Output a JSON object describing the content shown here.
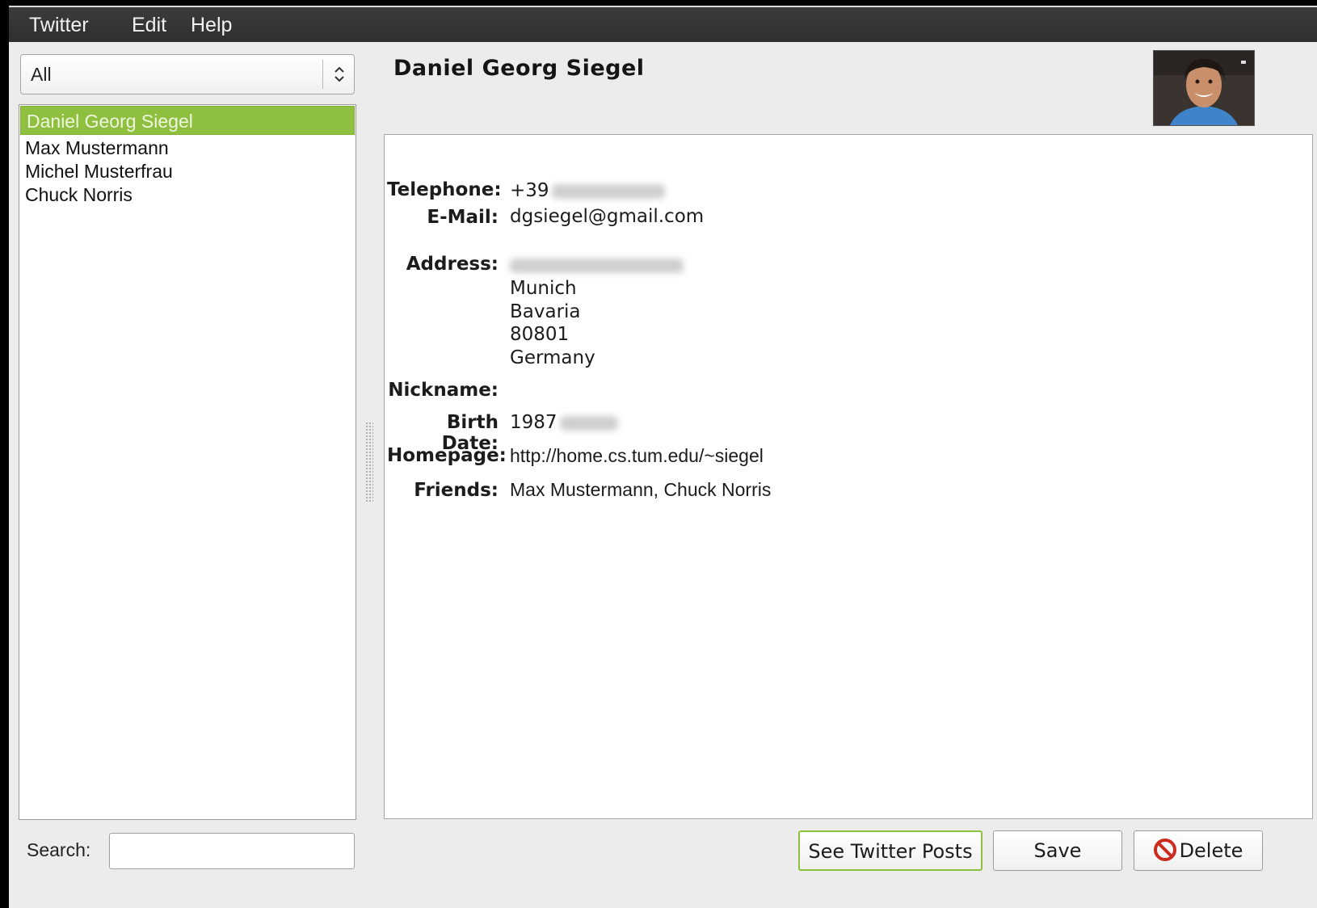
{
  "menu": {
    "items": [
      "Twitter",
      "Edit",
      "Help"
    ]
  },
  "sidebar": {
    "filter_value": "All",
    "contacts": [
      "Daniel Georg Siegel",
      "Max Mustermann",
      "Michel Musterfrau",
      "Chuck Norris"
    ],
    "selected_index": 0,
    "search_label": "Search:",
    "search_value": ""
  },
  "contact": {
    "name": "Daniel Georg Siegel",
    "fields": {
      "telephone_label": "Telephone:",
      "telephone_value": "+39",
      "email_label": "E-Mail:",
      "email_value": "dgsiegel@gmail.com",
      "address_label": "Address:",
      "address_lines": [
        "Munich",
        "Bavaria",
        "80801",
        "Germany"
      ],
      "nickname_label": "Nickname:",
      "nickname_value": "",
      "birthdate_label": "Birth Date:",
      "birthdate_value": "1987",
      "homepage_label": "Homepage:",
      "homepage_value": "http://home.cs.tum.edu/~siegel",
      "friends_label": "Friends:",
      "friends_value": "Max Mustermann, Chuck Norris"
    }
  },
  "buttons": {
    "twitter_posts": "See Twitter Posts",
    "save": "Save",
    "delete": "Delete"
  },
  "colors": {
    "selection": "#8fbf3f",
    "menubar": "#333333",
    "window_bg": "#ececec",
    "delete_icon": "#cc2a1e"
  }
}
